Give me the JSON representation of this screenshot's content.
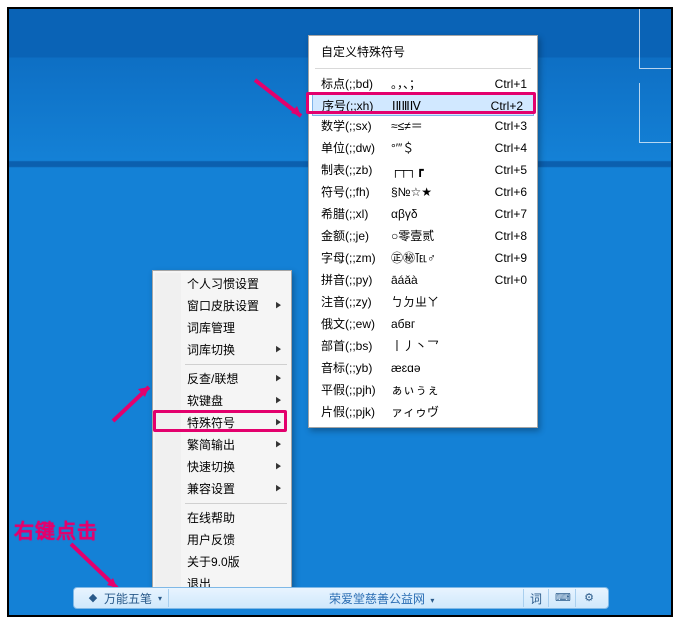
{
  "hint_label": "右键点击",
  "context_menu": {
    "groups": [
      [
        {
          "label": "个人习惯设置",
          "submenu": false
        },
        {
          "label": "窗口皮肤设置",
          "submenu": true
        },
        {
          "label": "词库管理",
          "submenu": false
        },
        {
          "label": "词库切换",
          "submenu": true
        }
      ],
      [
        {
          "label": "反查/联想",
          "submenu": true
        },
        {
          "label": "软键盘",
          "submenu": true
        },
        {
          "label": "特殊符号",
          "submenu": true,
          "highlight": true
        },
        {
          "label": "繁简输出",
          "submenu": true
        },
        {
          "label": "快速切换",
          "submenu": true
        },
        {
          "label": "兼容设置",
          "submenu": true
        }
      ],
      [
        {
          "label": "在线帮助",
          "submenu": false
        },
        {
          "label": "用户反馈",
          "submenu": false
        },
        {
          "label": "关于9.0版",
          "submenu": false
        },
        {
          "label": "退出",
          "submenu": false
        }
      ]
    ]
  },
  "symbol_menu": {
    "title": "自定义特殊符号",
    "items": [
      {
        "name": "标点(;;bd)",
        "sample": "。，、；",
        "key": "Ctrl+1"
      },
      {
        "name": "序号(;;xh)",
        "sample": "ⅠⅡⅢⅣ",
        "key": "Ctrl+2",
        "highlight": true,
        "selected": true
      },
      {
        "name": "数学(;;sx)",
        "sample": "≈≤≠＝",
        "key": "Ctrl+3"
      },
      {
        "name": "单位(;;dw)",
        "sample": "°′″＄",
        "key": "Ctrl+4"
      },
      {
        "name": "制表(;;zb)",
        "sample": "┌┬┐┏",
        "key": "Ctrl+5"
      },
      {
        "name": "符号(;;fh)",
        "sample": "§№☆★",
        "key": "Ctrl+6"
      },
      {
        "name": "希腊(;;xl)",
        "sample": "αβγδ",
        "key": "Ctrl+7"
      },
      {
        "name": "金额(;;je)",
        "sample": "○零壹贰",
        "key": "Ctrl+8"
      },
      {
        "name": "字母(;;zm)",
        "sample": "㊣㊙℡♂",
        "key": "Ctrl+9"
      },
      {
        "name": "拼音(;;py)",
        "sample": "āáǎà",
        "key": "Ctrl+0"
      },
      {
        "name": "注音(;;zy)",
        "sample": "ㄅㄉㄓㄚ",
        "key": ""
      },
      {
        "name": "俄文(;;ew)",
        "sample": "абвг",
        "key": ""
      },
      {
        "name": "部首(;;bs)",
        "sample": "丨丿丶乛",
        "key": ""
      },
      {
        "name": "音标(;;yb)",
        "sample": "æɛɑə",
        "key": ""
      },
      {
        "name": "平假(;;pjh)",
        "sample": "ぁぃぅぇ",
        "key": ""
      },
      {
        "name": "片假(;;pjk)",
        "sample": "ァィゥヴ",
        "key": ""
      }
    ]
  },
  "ime_bar": {
    "name_trunc": "万能五笔",
    "center_link": "荣爱堂慈善公益网",
    "word_btn": "词"
  }
}
